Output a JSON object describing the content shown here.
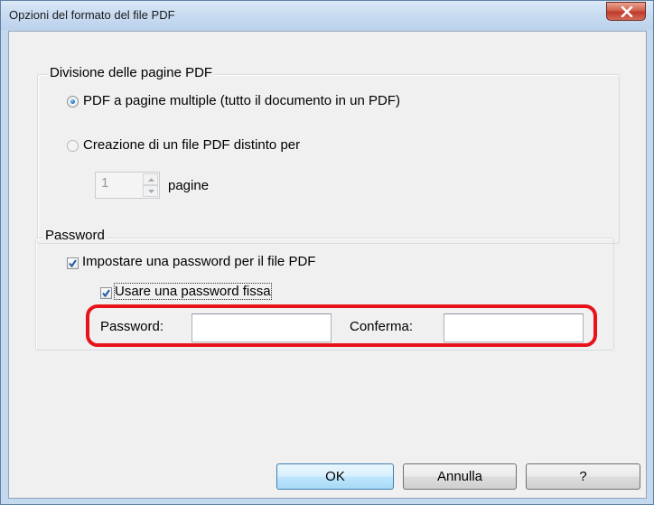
{
  "window": {
    "title": "Opzioni del formato del file PDF",
    "close_label": "x"
  },
  "pdf_pages_group": {
    "legend": "Divisione delle pagine PDF",
    "multi_page_option": {
      "label": "PDF a pagine multiple (tutto il documento in un PDF)",
      "selected": true
    },
    "separate_option": {
      "label": "Creazione di un file PDF distinto per",
      "selected": false
    },
    "pages_per_file": {
      "value": "1",
      "unit_label": "pagine",
      "enabled": false
    }
  },
  "password_group": {
    "legend": "Password",
    "set_password_checkbox": {
      "label": "Impostare una password per il file PDF",
      "checked": true
    },
    "fixed_password_checkbox": {
      "label": "Usare una password fissa",
      "checked": true
    },
    "password_field": {
      "label": "Password:",
      "value": ""
    },
    "confirm_field": {
      "label": "Conferma:",
      "value": ""
    }
  },
  "buttons": {
    "ok": "OK",
    "cancel": "Annulla",
    "help": "?"
  },
  "colors": {
    "highlight": "#e8121a",
    "check_mark": "#1c5aa6",
    "radio_dot": "#1f78c8"
  }
}
